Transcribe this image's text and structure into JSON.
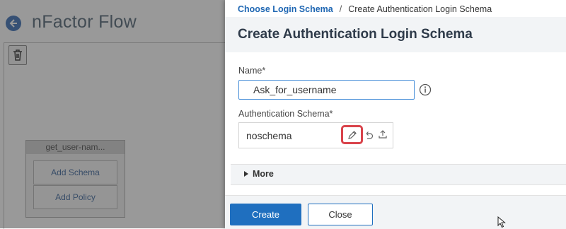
{
  "background": {
    "title": "nFactor Flow",
    "node": {
      "title": "get_user-nam...",
      "add_schema_label": "Add Schema",
      "add_policy_label": "Add Policy"
    }
  },
  "breadcrumb": {
    "parent": "Choose Login Schema",
    "separator": "/",
    "current": "Create Authentication Login Schema"
  },
  "panel": {
    "title": "Create Authentication Login Schema",
    "name_label": "Name*",
    "name_value": "Ask_for_username",
    "schema_label": "Authentication Schema*",
    "schema_value": "noschema",
    "more_label": "More"
  },
  "footer": {
    "create_label": "Create",
    "close_label": "Close"
  },
  "icons": {
    "back": "back-arrow-icon",
    "trash": "trash-icon",
    "info": "info-icon",
    "edit": "pencil-icon",
    "undo": "undo-icon",
    "upload": "upload-icon",
    "expand": "caret-right-icon"
  },
  "colors": {
    "accent": "#1f6fbf",
    "highlight": "#d9434b",
    "link": "#1f67b3"
  }
}
